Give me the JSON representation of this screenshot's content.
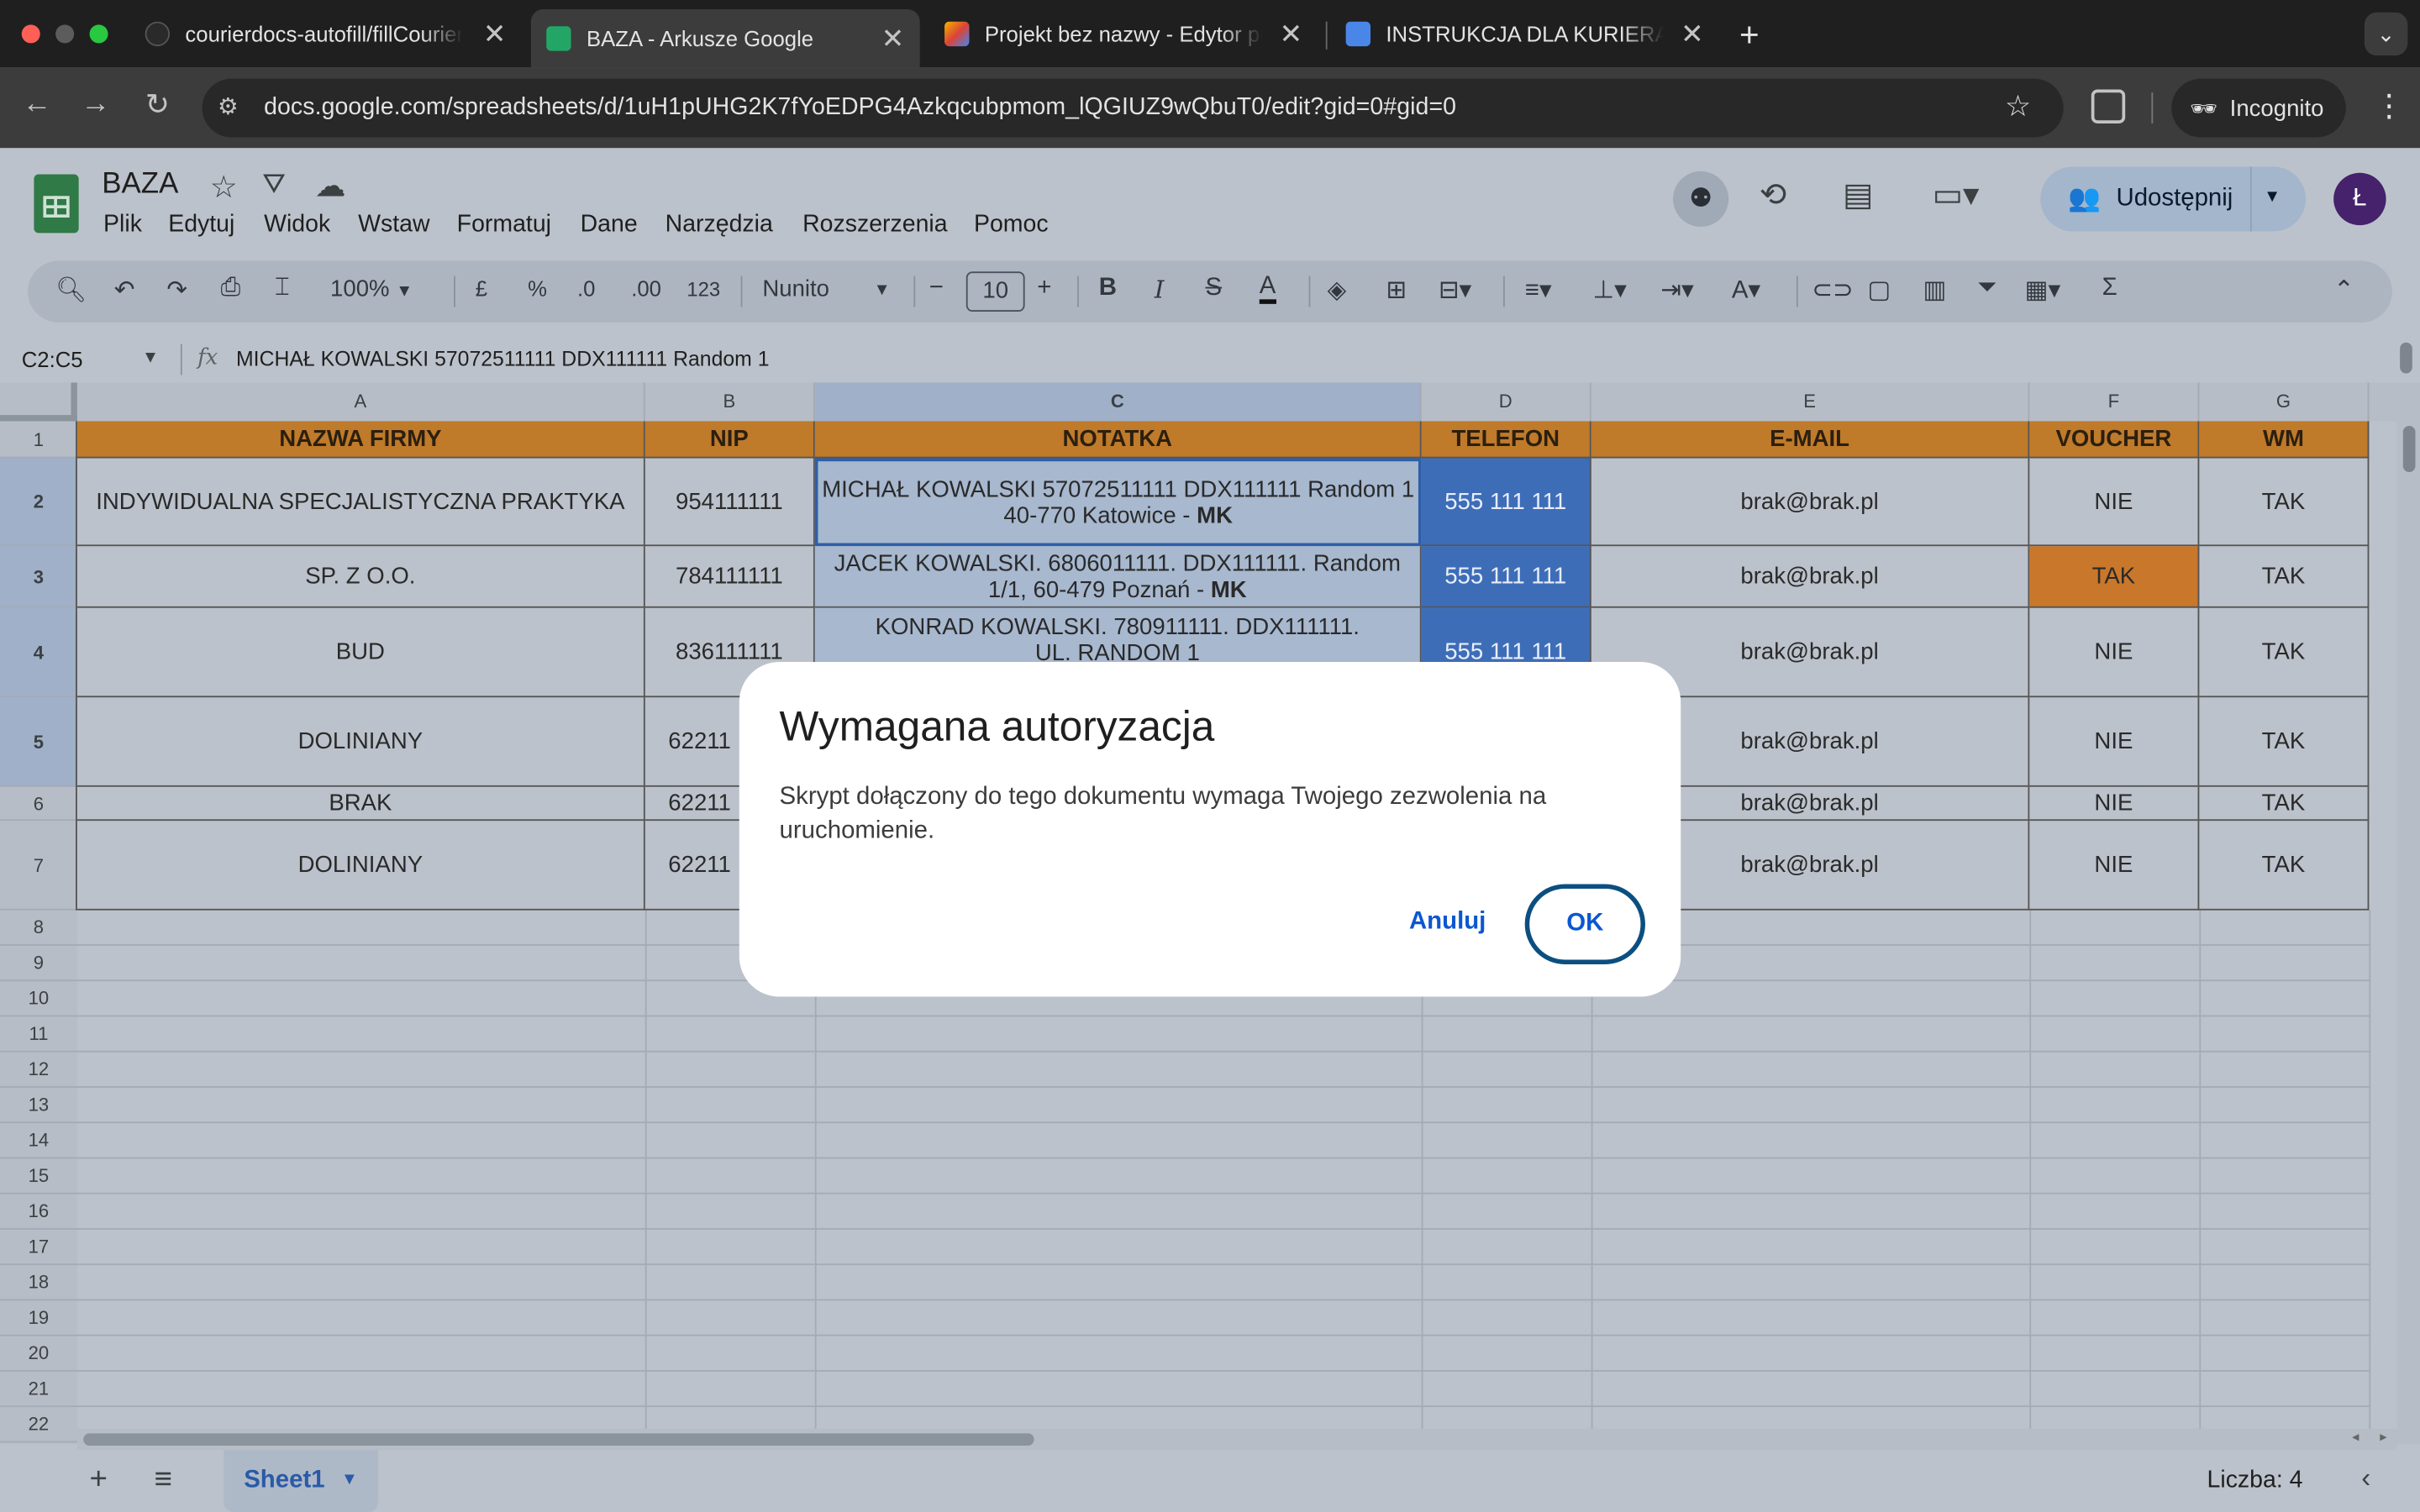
{
  "browser": {
    "tabs": [
      {
        "title": "courierdocs-autofill/fillCourier",
        "active": false
      },
      {
        "title": "BAZA - Arkusze Google",
        "active": true
      },
      {
        "title": "Projekt bez nazwy - Edytor pr",
        "active": false
      },
      {
        "title": "INSTRUKCJA DLA KURIERA -",
        "active": false
      }
    ],
    "url": "docs.google.com/spreadsheets/d/1uH1pUHG2K7fYoEDPG4Azkqcubpmom_lQGIUZ9wQbuT0/edit?gid=0#gid=0",
    "incognito_label": "Incognito"
  },
  "doc": {
    "title": "BAZA",
    "menu": [
      "Plik",
      "Edytuj",
      "Widok",
      "Wstaw",
      "Formatuj",
      "Dane",
      "Narzędzia",
      "Rozszerzenia",
      "Pomoc"
    ],
    "share_label": "Udostępnij",
    "avatar_letter": "Ł"
  },
  "toolbar": {
    "zoom": "100%",
    "currency": "£",
    "percent": "%",
    "dec_less": ".0",
    "dec_more": ".00",
    "format_123": "123",
    "font": "Nunito",
    "font_size": "10"
  },
  "formula_bar": {
    "range": "C2:C5",
    "fx": "fx",
    "content": "MICHAŁ KOWALSKI 57072511111 DDX111111 Random 1"
  },
  "grid": {
    "columns": [
      "A",
      "B",
      "C",
      "D",
      "E",
      "F",
      "G"
    ],
    "row_numbers": [
      "1",
      "2",
      "3",
      "4",
      "5",
      "6",
      "7",
      "8",
      "9",
      "10",
      "11",
      "12",
      "13",
      "14",
      "15",
      "16",
      "17",
      "18",
      "19",
      "20",
      "21",
      "22"
    ],
    "header": [
      "NAZWA FIRMY",
      "NIP",
      "NOTATKA",
      "TELEFON",
      "E-MAIL",
      "VOUCHER",
      "WM"
    ],
    "rows": [
      {
        "a": "INDYWIDUALNA SPECJALISTYCZNA PRAKTYKA",
        "b": "954111111",
        "c1": "MICHAŁ KOWALSKI 57072511111 DDX111111 Random 1",
        "c2": "40-770 Katowice - ",
        "c3": "MK",
        "d": "555 111 111",
        "e": "brak@brak.pl",
        "f": "NIE",
        "g": "TAK"
      },
      {
        "a": "SP. Z O.O.",
        "b": "784111111",
        "c1": "JACEK KOWALSKI. 6806011111. DDX111111. Random",
        "c2": "1/1, 60-479 Poznań - ",
        "c3": "MK",
        "d": "555 111 111",
        "e": "brak@brak.pl",
        "f": "TAK",
        "g": "TAK"
      },
      {
        "a": "BUD",
        "b": "836111111",
        "c1": "KONRAD KOWALSKI. 780911111. DDX111111.",
        "c2": "UL. RANDOM 1",
        "c3": "",
        "d": "555 111 111",
        "e": "brak@brak.pl",
        "f": "NIE",
        "g": "TAK"
      },
      {
        "a": "DOLINIANY",
        "b": "62211",
        "c1": "",
        "c2": "",
        "c3": "",
        "d": "",
        "e": "brak@brak.pl",
        "f": "NIE",
        "g": "TAK"
      },
      {
        "a": "BRAK",
        "b": "62211",
        "c1": "",
        "c2": "",
        "c3": "",
        "d": "",
        "e": "brak@brak.pl",
        "f": "NIE",
        "g": "TAK"
      },
      {
        "a": "DOLINIANY",
        "b": "62211",
        "c1": "",
        "c2": "",
        "c3": "",
        "d": "",
        "e": "brak@brak.pl",
        "f": "NIE",
        "g": "TAK"
      }
    ]
  },
  "bottom": {
    "sheet_tab": "Sheet1",
    "status": "Liczba: 4"
  },
  "dialog": {
    "title": "Wymagana autoryzacja",
    "body": "Skrypt dołączony do tego dokumentu wymaga Twojego zezwolenia na uruchomienie.",
    "cancel_label": "Anuluj",
    "ok_label": "OK"
  },
  "colors": {
    "header_fill": "#bf7a2a",
    "selection_blue": "#3e6db8",
    "voucher_highlight": "#c9772a",
    "dialog_link": "#0b57d0"
  }
}
